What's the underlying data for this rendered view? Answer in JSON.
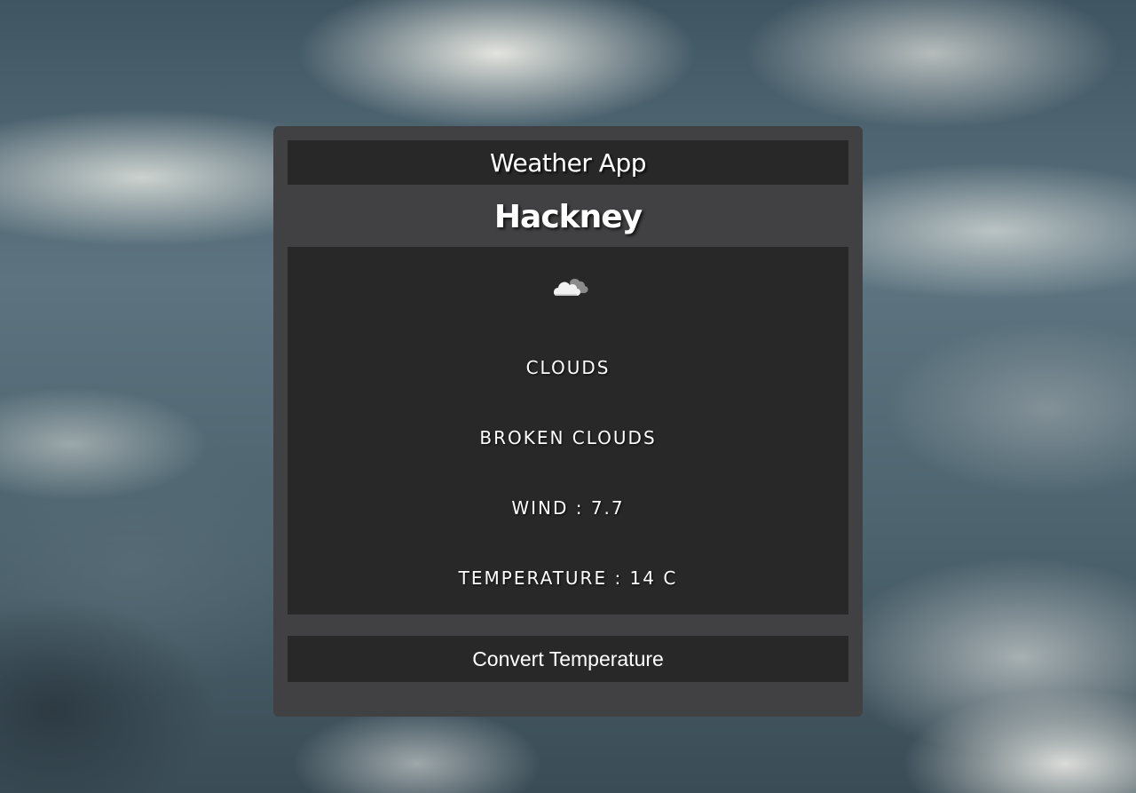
{
  "app": {
    "title": "Weather App"
  },
  "location": {
    "city": "Hackney"
  },
  "weather": {
    "icon": "cloud-icon",
    "main": "Clouds",
    "description": "broken clouds",
    "wind_label": "Wind",
    "wind_value": "7.7",
    "wind_text": "Wind : 7.7",
    "temperature_label": "Temperature",
    "temperature_value": "14",
    "temperature_unit": "C",
    "temperature_text": "Temperature : 14 C"
  },
  "actions": {
    "convert_label": "Convert Temperature"
  },
  "colors": {
    "card_bg": "#414042",
    "panel_bg": "#282828",
    "text": "#ffffff"
  }
}
